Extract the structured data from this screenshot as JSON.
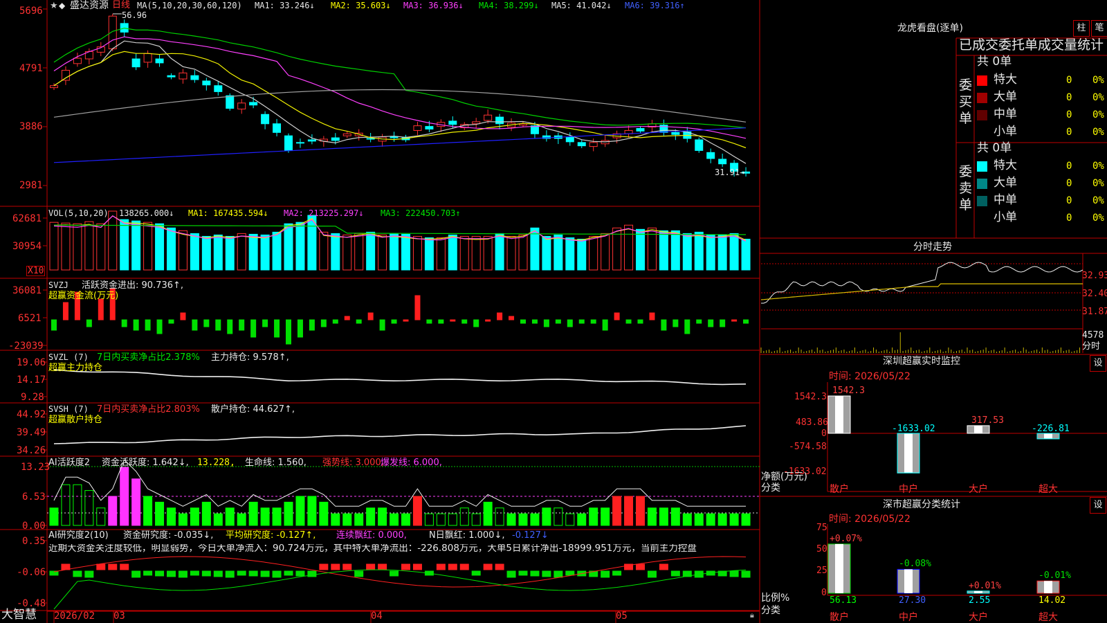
{
  "colors": {
    "up": "#ff3232",
    "down": "#00ffff",
    "ma_white": "#d0d0d0",
    "ma_yellow": "#f0f000",
    "ma_magenta": "#ff40ff",
    "ma_green": "#00d000",
    "ma_gray": "#a0a0a0",
    "ma_blue": "#2020ff",
    "grid": "#c00000"
  },
  "main": {
    "stock_name": "盛达资源",
    "period": "日线",
    "ma_label": "MA(5,10,20,30,60,120)",
    "ma1": "MA1: 33.246↓",
    "ma2": "MA2: 35.603↓",
    "ma3": "MA3: 36.936↓",
    "ma4": "MA4: 38.299↓",
    "ma5": "MA5: 41.042↓",
    "ma6": "MA6: 39.316↑",
    "high_label": "56.96",
    "low_label": "31.91→",
    "y_ticks": [
      "5696",
      "4791",
      "3886",
      "2981"
    ]
  },
  "vol": {
    "label": "VOL(5,10,20)",
    "value": "138265.000↓",
    "ma1": "MA1: 167435.594↓",
    "ma2": "MA2: 213225.297↓",
    "ma3": "MA3: 222450.703↑",
    "y_ticks": [
      "62681",
      "30954"
    ],
    "unit": "X10"
  },
  "svzj": {
    "label": "SVZJ",
    "text": "活跃资金进出: 90.736↑,",
    "sub": "超赢资金流(万元)",
    "y_ticks": [
      "36081",
      "6521",
      "-23039"
    ]
  },
  "svzl": {
    "label": "SVZL (7)",
    "text1": "7日内买卖净占比2.378%",
    "text2": "主力持仓: 9.578↑,",
    "sub": "超赢主力持仓",
    "y_ticks": [
      "19.06",
      "14.17",
      "9.28"
    ]
  },
  "svsh": {
    "label": "SVSH (7)",
    "text1": "7日内买卖净占比2.803%",
    "text2": "散户持仓: 44.627↑,",
    "sub": "超赢散户持仓",
    "y_ticks": [
      "44.92",
      "39.49",
      "34.26"
    ]
  },
  "ai1": {
    "label": "AI活跃度2",
    "t1": "资金活跃度: 1.642↓,",
    "t2": "13.228,",
    "t3": "生命线: 1.560,",
    "t4": "强势线: 3.000,",
    "t5": "爆发线: 6.000,",
    "y_ticks": [
      "13.23",
      "6.53",
      "0.00"
    ]
  },
  "ai2": {
    "label": "AI研究度2(10)",
    "t1": "资金研究度: -0.035↓,",
    "t2": "平均研究度: -0.127↑,",
    "t3": "连续飘红: 0.000,",
    "t4": "N日飘红: 1.000↓,",
    "t5": "-0.127↓",
    "note": "近期大资金关注度较低，明显弱势，今日大单净流入：90.724万元，其中特大单净流出：-226.808万元，大单5日累计净出-18999.951万元，当前主力控盘",
    "y_ticks": [
      "0.35",
      "-0.06",
      "-0.48"
    ]
  },
  "xaxis": {
    "brand": "大智慧",
    "labels": [
      "2026/02",
      "03",
      "04",
      "05"
    ]
  },
  "lhb": {
    "title": "龙虎看盘(逐单)",
    "btn1": "柱",
    "btn2": "笔",
    "header": "已成交委托单成交量统计",
    "buy": {
      "side": "委买单",
      "total": "共 0单",
      "rows": [
        {
          "name": "特大",
          "qty": "0",
          "pct": "0%",
          "color": "#ff0000"
        },
        {
          "name": "大单",
          "qty": "0",
          "pct": "0%",
          "color": "#a00000"
        },
        {
          "name": "中单",
          "qty": "0",
          "pct": "0%",
          "color": "#600000"
        },
        {
          "name": "小单",
          "qty": "0",
          "pct": "0%",
          "color": ""
        }
      ]
    },
    "sell": {
      "side": "委卖单",
      "total": "共 0单",
      "rows": [
        {
          "name": "特大",
          "qty": "0",
          "pct": "0%",
          "color": "#00ffff"
        },
        {
          "name": "大单",
          "qty": "0",
          "pct": "0%",
          "color": "#008888"
        },
        {
          "name": "中单",
          "qty": "0",
          "pct": "0%",
          "color": "#006060"
        },
        {
          "name": "小单",
          "qty": "0",
          "pct": "0%",
          "color": ""
        }
      ]
    }
  },
  "intraday": {
    "title": "分时走势",
    "prices": [
      "32.93",
      "32.40",
      "31.87"
    ],
    "vol": "4578",
    "unit": "分时"
  },
  "sz_monitor": {
    "title": "深圳超赢实时监控",
    "btn": "设",
    "time": "时间: 2026/05/22",
    "y_ticks": [
      "1542.3",
      "483.86",
      "0",
      "-574.58",
      "-1633.02"
    ],
    "ylabel": "净额(万元)",
    "xlabel": "分类",
    "chart_data": {
      "type": "bar",
      "categories": [
        "散户",
        "中户",
        "大户",
        "超大"
      ],
      "values": [
        1542.3,
        -1633.02,
        317.53,
        -226.81
      ],
      "value_labels": [
        "1542.3",
        "-1633.02",
        "317.53",
        "-226.81"
      ],
      "ylim": [
        -1633.02,
        1542.3
      ]
    }
  },
  "sz_class": {
    "title": "深市超赢分类统计",
    "btn": "设",
    "time": "时间: 2026/05/22",
    "y_ticks": [
      "75",
      "50",
      "25",
      "0"
    ],
    "ylabel": "比例%",
    "xlabel": "分类",
    "chart_data": {
      "type": "bar",
      "categories": [
        "散户",
        "中户",
        "大户",
        "超大"
      ],
      "values": [
        56.13,
        27.3,
        2.55,
        14.02
      ],
      "changes": [
        "+0.07%",
        "-0.08%",
        "+0.01%",
        "-0.01%"
      ],
      "ylim": [
        0,
        75
      ]
    }
  }
}
